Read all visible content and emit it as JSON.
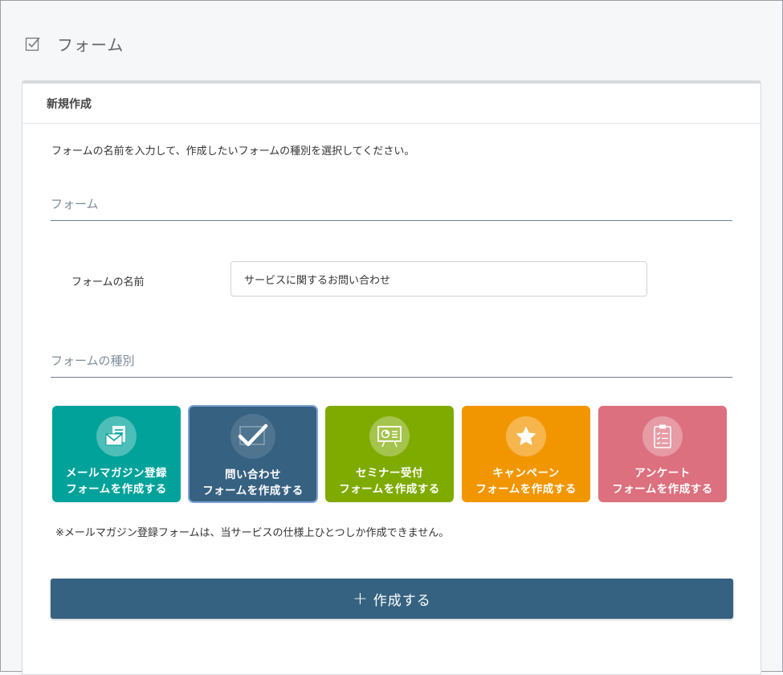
{
  "page": {
    "title": "フォーム"
  },
  "card": {
    "title": "新規作成",
    "lead": "フォームの名前を入力して、作成したいフォームの種別を選択してください。",
    "section_form": "フォーム",
    "name_label": "フォームの名前",
    "name_value": "サービスに関するお問い合わせ",
    "section_type": "フォームの種別",
    "types": [
      {
        "line1": "メールマガジン登録",
        "line2": "フォームを作成する",
        "color": "#00a29a",
        "icon": "newsletter-icon"
      },
      {
        "line1": "問い合わせ",
        "line2": "フォームを作成する",
        "color": "#376181",
        "icon": "checkmark-icon",
        "selected": true
      },
      {
        "line1": "セミナー受付",
        "line2": "フォームを作成する",
        "color": "#7fab00",
        "icon": "presentation-board-icon"
      },
      {
        "line1": "キャンペーン",
        "line2": "フォームを作成する",
        "color": "#f29600",
        "icon": "star-icon"
      },
      {
        "line1": "アンケート",
        "line2": "フォームを作成する",
        "color": "#dc707e",
        "icon": "clipboard-checklist-icon"
      }
    ],
    "note": "※メールマガジン登録フォームは、当サービスの仕様上ひとつしか作成できません。",
    "submit_label": "作成する",
    "submit_icon": "plus-icon"
  }
}
